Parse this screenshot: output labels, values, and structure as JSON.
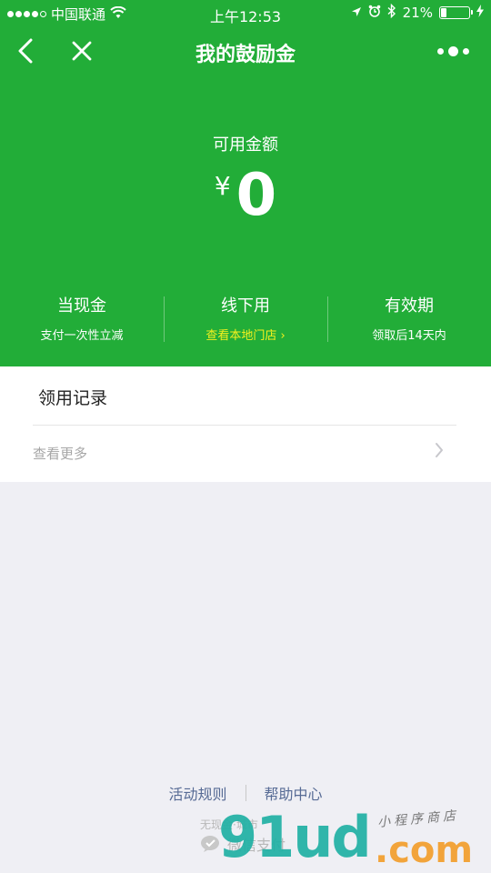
{
  "status_bar": {
    "carrier": "中国联通",
    "time": "上午12:53",
    "battery_percent_label": "21%",
    "battery_level": 0.21
  },
  "nav": {
    "title": "我的鼓励金"
  },
  "balance": {
    "label": "可用金额",
    "currency": "¥",
    "amount": "0"
  },
  "features": [
    {
      "title": "当现金",
      "subtitle": "支付一次性立减"
    },
    {
      "title": "线下用",
      "subtitle": "查看本地门店 ›"
    },
    {
      "title": "有效期",
      "subtitle": "领取后14天内"
    }
  ],
  "records": {
    "title": "领用记录",
    "more_label": "查看更多"
  },
  "footer": {
    "rules_link": "活动规则",
    "help_link": "帮助中心",
    "powered_text": "无现金·城市",
    "brand_text": "微信支付"
  },
  "watermark": {
    "number": "91ud",
    "domain": ".com",
    "tagline": "小程序商店"
  },
  "colors": {
    "brand_green": "#22ad38",
    "link_yellow": "#f4f01e",
    "link_blue": "#576b95"
  }
}
